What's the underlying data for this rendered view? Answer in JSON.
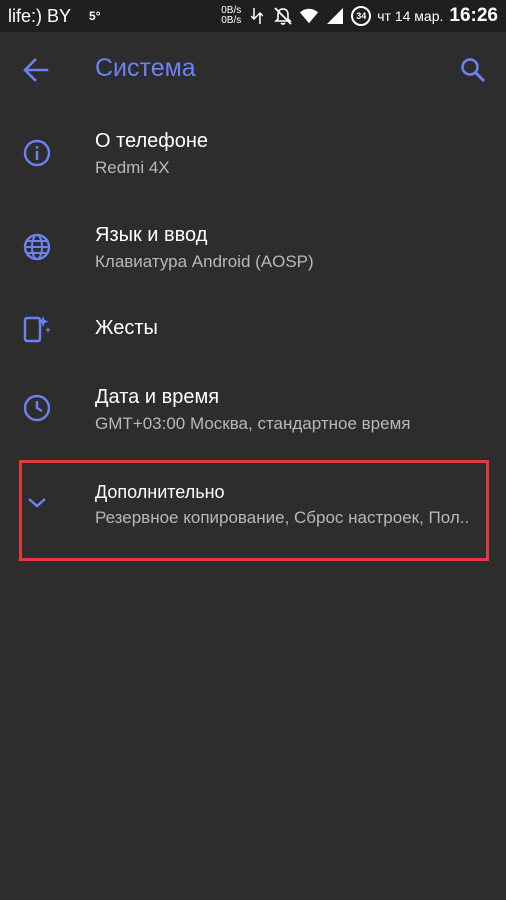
{
  "status": {
    "carrier": "life:) BY",
    "temperature": "5°",
    "net_up": "0B/s",
    "net_down": "0B/s",
    "battery": "34",
    "date": "чт 14 мар.",
    "time": "16:26"
  },
  "toolbar": {
    "title": "Система"
  },
  "items": [
    {
      "title": "О телефоне",
      "subtitle": "Redmi 4X",
      "icon": "info-icon"
    },
    {
      "title": "Язык и ввод",
      "subtitle": "Клавиатура Android (AOSP)",
      "icon": "globe-icon"
    },
    {
      "title": "Жесты",
      "subtitle": "",
      "icon": "gesture-phone-icon"
    },
    {
      "title": "Дата и время",
      "subtitle": "GMT+03:00 Москва, стандартное время",
      "icon": "clock-icon"
    },
    {
      "title": "Дополнительно",
      "subtitle": "Резервное копирование, Сброс настроек, Пол..",
      "icon": "chevron-down-icon"
    }
  ],
  "colors": {
    "accent": "#6b83f2",
    "background": "#2d2d2d",
    "highlight": "#e0393e"
  }
}
